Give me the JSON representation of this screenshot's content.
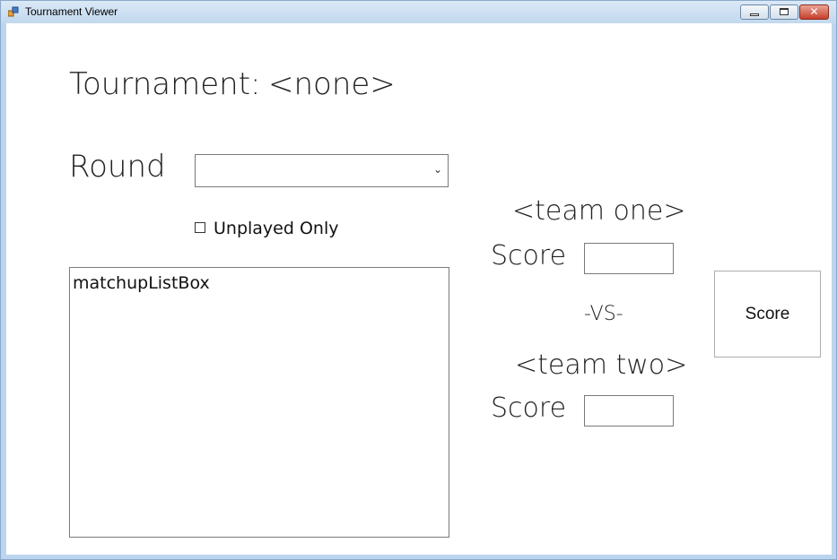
{
  "window": {
    "title": "Tournament Viewer"
  },
  "header": {
    "tournament_label": "Tournament:",
    "tournament_name": "<none>"
  },
  "round": {
    "label": "Round",
    "selected_value": ""
  },
  "filter": {
    "unplayed_only_label": "Unplayed Only",
    "checked": false
  },
  "matchups": {
    "placeholder_item": "matchupListBox"
  },
  "team_one": {
    "name": "<team one>",
    "score_label": "Score",
    "score_value": ""
  },
  "versus": {
    "label": "-VS-"
  },
  "team_two": {
    "name": "<team two>",
    "score_label": "Score",
    "score_value": ""
  },
  "actions": {
    "score_button_label": "Score"
  },
  "colors": {
    "title_bar": "#c2d8ee",
    "close_button": "#c6402a"
  },
  "icons": {
    "app": "form-app-icon",
    "minimize": "minimize-icon",
    "maximize": "maximize-icon",
    "close": "close-icon",
    "dropdown": "chevron-down-icon"
  }
}
